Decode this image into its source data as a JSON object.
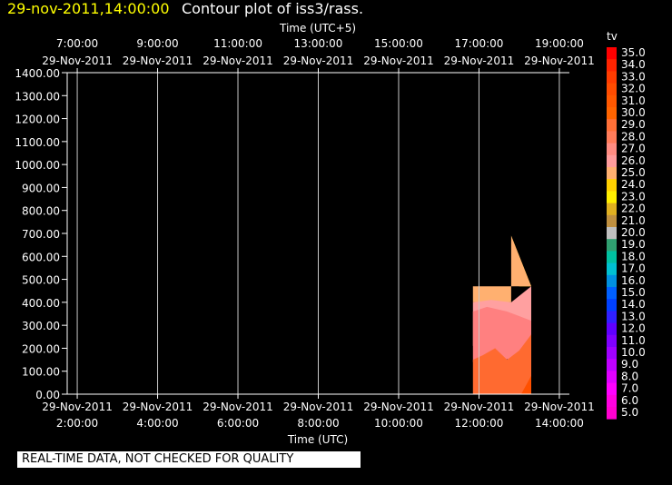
{
  "header": {
    "timestamp": "29-nov-2011,14:00:00",
    "title": "Contour plot of iss3/rass."
  },
  "footer": {
    "quality_note": "REAL-TIME DATA, NOT CHECKED FOR QUALITY"
  },
  "chart_data": {
    "type": "heatmap",
    "xlabel_top": "Time (UTC+5)",
    "xlabel_bottom": "Time (UTC)",
    "ylabel": "",
    "ylim": [
      0,
      1400
    ],
    "y_ticks": [
      "0.00",
      "100.00",
      "200.00",
      "300.00",
      "400.00",
      "500.00",
      "600.00",
      "700.00",
      "800.00",
      "900.00",
      "1000.00",
      "1100.00",
      "1200.00",
      "1300.00",
      "1400.00"
    ],
    "x_range_hours_utc": [
      1.75,
      14.25
    ],
    "x_ticks_top": [
      {
        "time": "7:00:00",
        "date": "29-Nov-2011"
      },
      {
        "time": "9:00:00",
        "date": "29-Nov-2011"
      },
      {
        "time": "11:00:00",
        "date": "29-Nov-2011"
      },
      {
        "time": "13:00:00",
        "date": "29-Nov-2011"
      },
      {
        "time": "15:00:00",
        "date": "29-Nov-2011"
      },
      {
        "time": "17:00:00",
        "date": "29-Nov-2011"
      },
      {
        "time": "19:00:00",
        "date": "29-Nov-2011"
      }
    ],
    "x_ticks_bottom": [
      {
        "date": "29-Nov-2011",
        "time": "2:00:00"
      },
      {
        "date": "29-Nov-2011",
        "time": "4:00:00"
      },
      {
        "date": "29-Nov-2011",
        "time": "6:00:00"
      },
      {
        "date": "29-Nov-2011",
        "time": "8:00:00"
      },
      {
        "date": "29-Nov-2011",
        "time": "10:00:00"
      },
      {
        "date": "29-Nov-2011",
        "time": "12:00:00"
      },
      {
        "date": "29-Nov-2011",
        "time": "14:00:00"
      }
    ],
    "x_tick_hours_utc": [
      2,
      4,
      6,
      8,
      10,
      12,
      14
    ],
    "grid": true,
    "colorbar": {
      "label": "tv",
      "levels": [
        "35.0",
        "34.0",
        "33.0",
        "32.0",
        "31.0",
        "30.0",
        "29.0",
        "28.0",
        "27.0",
        "26.0",
        "25.0",
        "24.0",
        "23.0",
        "22.0",
        "21.0",
        "20.0",
        "19.0",
        "18.0",
        "17.0",
        "16.0",
        "15.0",
        "14.0",
        "13.0",
        "12.0",
        "11.0",
        "10.0",
        "9.0",
        "8.0",
        "7.0",
        "6.0",
        "5.0"
      ],
      "colors": [
        "#ff0000",
        "#ff2400",
        "#ff3c00",
        "#ff4c00",
        "#ff5800",
        "#ff6400",
        "#ff7038",
        "#ff7c5a",
        "#ff8c82",
        "#ff9c9c",
        "#ffb070",
        "#ffd000",
        "#ffee00",
        "#e0b020",
        "#c09040",
        "#c0c0c0",
        "#30a070",
        "#00c0a0",
        "#00c0d0",
        "#0090e0",
        "#0060ff",
        "#0040ff",
        "#3020ff",
        "#6000ff",
        "#8000ff",
        "#a000ff",
        "#c000ff",
        "#e000ff",
        "#ff00ff",
        "#ff00e0",
        "#ff00d0"
      ]
    },
    "contours": [
      {
        "tv": "23.0",
        "color": "#ffd800",
        "points": [
          [
            12.8,
            690
          ],
          [
            13.3,
            470
          ],
          [
            13.0,
            470
          ]
        ]
      },
      {
        "tv": "25.0",
        "color": "#ffb070",
        "points": [
          [
            11.85,
            470
          ],
          [
            13.3,
            470
          ],
          [
            12.8,
            690
          ],
          [
            12.8,
            400
          ],
          [
            11.85,
            400
          ]
        ]
      },
      {
        "tv": "26.0",
        "color": "#ffa0a0",
        "points": [
          [
            11.85,
            400
          ],
          [
            12.3,
            410
          ],
          [
            12.8,
            400
          ],
          [
            13.3,
            470
          ],
          [
            13.3,
            210
          ],
          [
            11.85,
            210
          ]
        ]
      },
      {
        "tv": "27.0",
        "color": "#ff8080",
        "points": [
          [
            11.85,
            360
          ],
          [
            12.2,
            380
          ],
          [
            12.7,
            360
          ],
          [
            13.0,
            340
          ],
          [
            13.3,
            320
          ],
          [
            13.3,
            160
          ],
          [
            11.85,
            140
          ]
        ]
      },
      {
        "tv": "29.0",
        "color": "#ff6a30",
        "points": [
          [
            11.85,
            150
          ],
          [
            12.1,
            170
          ],
          [
            12.4,
            200
          ],
          [
            12.7,
            150
          ],
          [
            13.0,
            190
          ],
          [
            13.3,
            260
          ],
          [
            13.3,
            0
          ],
          [
            11.85,
            0
          ]
        ]
      },
      {
        "tv": "31.0",
        "color": "#ff5000",
        "points": [
          [
            13.05,
            0
          ],
          [
            13.3,
            80
          ],
          [
            13.3,
            0
          ]
        ]
      }
    ]
  }
}
